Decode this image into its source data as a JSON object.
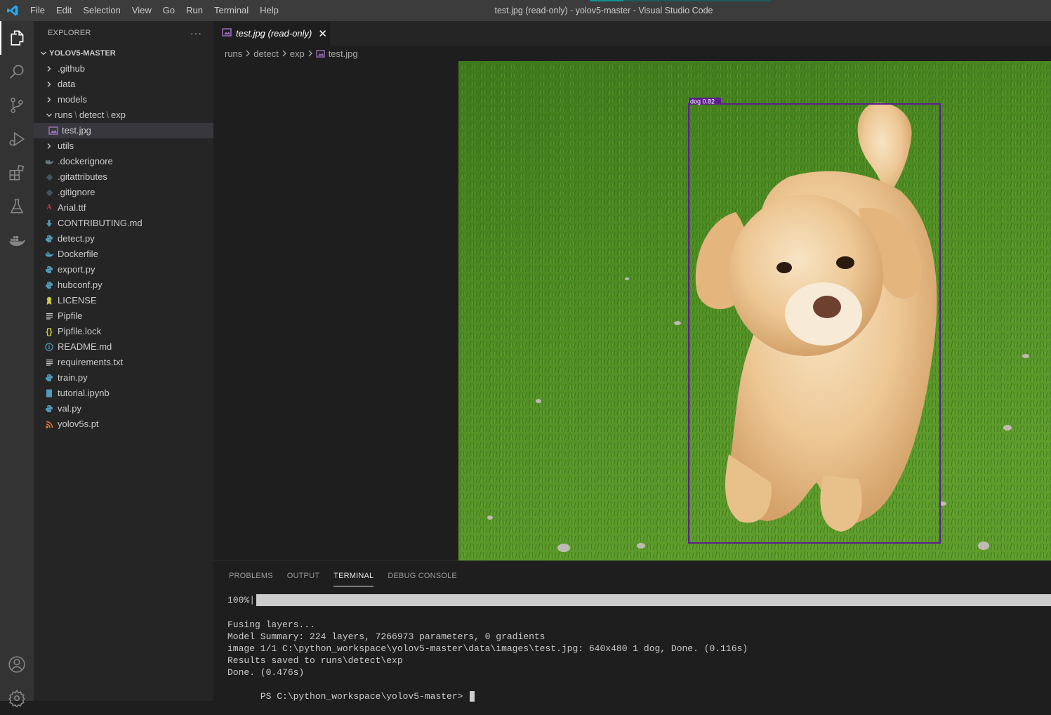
{
  "window": {
    "title": "test.jpg (read-only) - yolov5-master - Visual Studio Code",
    "menu": [
      "File",
      "Edit",
      "Selection",
      "View",
      "Go",
      "Run",
      "Terminal",
      "Help"
    ]
  },
  "activity_bar": {
    "items": [
      "explorer-icon",
      "search-icon",
      "source-control-icon",
      "run-debug-icon",
      "extensions-icon",
      "testing-icon",
      "docker-icon"
    ],
    "bottom": [
      "account-icon",
      "settings-gear-icon"
    ]
  },
  "sidebar": {
    "header": "EXPLORER",
    "more": "···",
    "root": "YOLOV5-MASTER",
    "compact_path": [
      "runs",
      "detect",
      "exp"
    ],
    "items": [
      {
        "label": ".github",
        "type": "folder"
      },
      {
        "label": "data",
        "type": "folder"
      },
      {
        "label": "models",
        "type": "folder"
      },
      {
        "label": "test.jpg",
        "type": "image",
        "selected": true
      },
      {
        "label": "utils",
        "type": "folder"
      },
      {
        "label": ".dockerignore",
        "type": "docker-ignore"
      },
      {
        "label": ".gitattributes",
        "type": "git"
      },
      {
        "label": ".gitignore",
        "type": "git"
      },
      {
        "label": "Arial.ttf",
        "type": "font"
      },
      {
        "label": "CONTRIBUTING.md",
        "type": "markdown-contrib"
      },
      {
        "label": "detect.py",
        "type": "python"
      },
      {
        "label": "Dockerfile",
        "type": "docker"
      },
      {
        "label": "export.py",
        "type": "python"
      },
      {
        "label": "hubconf.py",
        "type": "python"
      },
      {
        "label": "LICENSE",
        "type": "license"
      },
      {
        "label": "Pipfile",
        "type": "text"
      },
      {
        "label": "Pipfile.lock",
        "type": "json"
      },
      {
        "label": "README.md",
        "type": "info"
      },
      {
        "label": "requirements.txt",
        "type": "text"
      },
      {
        "label": "train.py",
        "type": "python"
      },
      {
        "label": "tutorial.ipynb",
        "type": "notebook"
      },
      {
        "label": "val.py",
        "type": "python"
      },
      {
        "label": "yolov5s.pt",
        "type": "rss"
      }
    ]
  },
  "editor": {
    "tab_label": "test.jpg (read-only)",
    "breadcrumb": [
      "runs",
      "detect",
      "exp",
      "test.jpg"
    ],
    "detection_label": "dog 0.82"
  },
  "panel": {
    "tabs": [
      "PROBLEMS",
      "OUTPUT",
      "TERMINAL",
      "DEBUG CONSOLE"
    ],
    "active_tab": "TERMINAL",
    "progress_label": "100%|",
    "progress_fraction": 1.0,
    "terminal_lines": [
      "Fusing layers...",
      "Model Summary: 224 layers, 7266973 parameters, 0 gradients",
      "image 1/1 C:\\python_workspace\\yolov5-master\\data\\images\\test.jpg: 640x480 1 dog, Done. (0.116s)",
      "Results saved to runs\\detect\\exp",
      "Done. (0.476s)"
    ],
    "prompt": "PS C:\\python_workspace\\yolov5-master> "
  },
  "colors": {
    "accent": "#0078d4",
    "detection_box": "#5c1f8c",
    "python_icon": "#519aba",
    "image_icon": "#a074c4"
  }
}
